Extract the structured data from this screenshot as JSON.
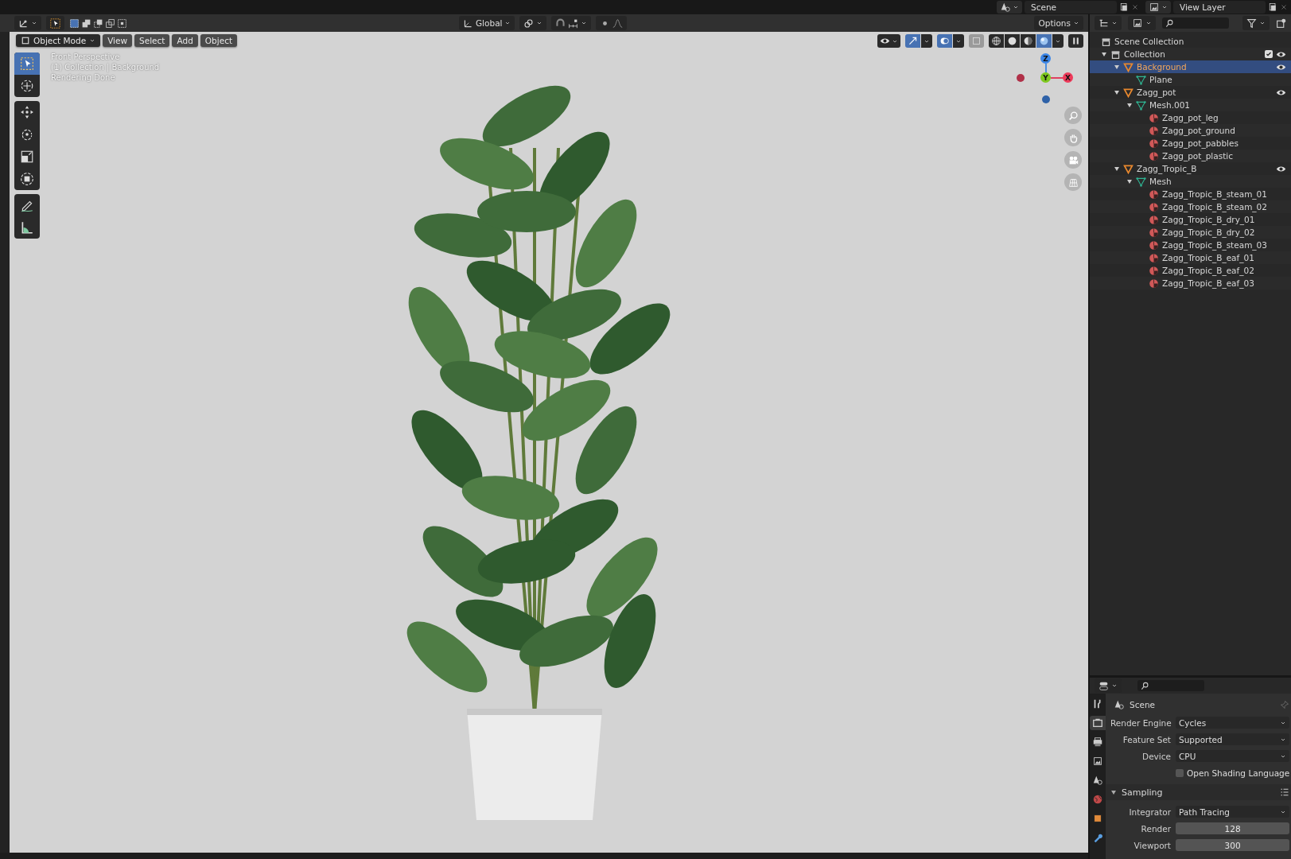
{
  "topbar": {
    "scene": "Scene",
    "view_layer": "View Layer"
  },
  "tool_header": {
    "orientation": "Global",
    "options": "Options"
  },
  "viewport_header": {
    "mode": "Object Mode",
    "menus": [
      "View",
      "Select",
      "Add",
      "Object"
    ]
  },
  "tools": [
    {
      "kind": "select",
      "selected": true
    },
    {
      "kind": "cursor",
      "selected": false
    },
    {
      "kind": "move",
      "selected": false
    },
    {
      "kind": "rotate",
      "selected": false
    },
    {
      "kind": "scale",
      "selected": false
    },
    {
      "kind": "transform",
      "selected": false
    },
    {
      "kind": "annotate",
      "selected": false
    },
    {
      "kind": "measure",
      "selected": false
    }
  ],
  "overlay_text": [
    "Front Perspective",
    "(1) Collection | Background",
    "Rendering Done"
  ],
  "gizmo": {
    "z": "Z",
    "y": "Y",
    "x": "X"
  },
  "shading": [
    {
      "kind": "wireframe",
      "selected": false
    },
    {
      "kind": "solid",
      "selected": false
    },
    {
      "kind": "material",
      "selected": false
    },
    {
      "kind": "rendered",
      "selected": true
    }
  ],
  "outliner": {
    "root": "Scene Collection",
    "tree": [
      {
        "name": "Collection",
        "kind": "collection",
        "expanded": true,
        "checked": true,
        "visible": true,
        "selected": false,
        "children": [
          {
            "name": "Background",
            "kind": "object",
            "expanded": true,
            "visible": true,
            "selected": true,
            "children": [
              {
                "name": "Plane",
                "kind": "mesh",
                "selected": false
              }
            ]
          },
          {
            "name": "Zagg_pot",
            "kind": "object",
            "expanded": true,
            "visible": true,
            "selected": false,
            "children": [
              {
                "name": "Mesh.001",
                "kind": "mesh",
                "expanded": true,
                "selected": false,
                "children": [
                  {
                    "name": "Zagg_pot_leg",
                    "kind": "material",
                    "selected": false
                  },
                  {
                    "name": "Zagg_pot_ground",
                    "kind": "material",
                    "selected": false
                  },
                  {
                    "name": "Zagg_pot_pabbles",
                    "kind": "material",
                    "selected": false
                  },
                  {
                    "name": "Zagg_pot_plastic",
                    "kind": "material",
                    "selected": false
                  }
                ]
              }
            ]
          },
          {
            "name": "Zagg_Tropic_B",
            "kind": "object",
            "expanded": true,
            "visible": true,
            "selected": false,
            "children": [
              {
                "name": "Mesh",
                "kind": "mesh",
                "expanded": true,
                "selected": false,
                "children": [
                  {
                    "name": "Zagg_Tropic_B_steam_01",
                    "kind": "material",
                    "selected": false
                  },
                  {
                    "name": "Zagg_Tropic_B_steam_02",
                    "kind": "material",
                    "selected": false
                  },
                  {
                    "name": "Zagg_Tropic_B_dry_01",
                    "kind": "material",
                    "selected": false
                  },
                  {
                    "name": "Zagg_Tropic_B_dry_02",
                    "kind": "material",
                    "selected": false
                  },
                  {
                    "name": "Zagg_Tropic_B_steam_03",
                    "kind": "material",
                    "selected": false
                  },
                  {
                    "name": "Zagg_Tropic_B_eaf_01",
                    "kind": "material",
                    "selected": false
                  },
                  {
                    "name": "Zagg_Tropic_B_eaf_02",
                    "kind": "material",
                    "selected": false
                  },
                  {
                    "name": "Zagg_Tropic_B_eaf_03",
                    "kind": "material",
                    "selected": false
                  }
                ]
              }
            ]
          }
        ]
      }
    ]
  },
  "properties": {
    "tabs": [
      {
        "kind": "tool",
        "selected": false
      },
      {
        "kind": "render",
        "selected": true
      },
      {
        "kind": "output",
        "selected": false
      },
      {
        "kind": "view_layer",
        "selected": false
      },
      {
        "kind": "scene",
        "selected": false
      },
      {
        "kind": "world",
        "selected": false
      },
      {
        "kind": "object",
        "selected": false
      },
      {
        "kind": "modifier",
        "selected": false
      }
    ],
    "context": "Scene",
    "fields": [
      {
        "kind": "dropdown",
        "label": "Render Engine",
        "value": "Cycles"
      },
      {
        "kind": "dropdown",
        "label": "Feature Set",
        "value": "Supported"
      },
      {
        "kind": "dropdown",
        "label": "Device",
        "value": "CPU"
      },
      {
        "kind": "checkbox",
        "label": "Open Shading Language",
        "checked": false
      }
    ],
    "section": {
      "title": "Sampling",
      "expanded": true
    },
    "section_fields": [
      {
        "kind": "dropdown",
        "label": "Integrator",
        "value": "Path Tracing"
      },
      {
        "kind": "number",
        "label": "Render",
        "value": "128"
      },
      {
        "kind": "number",
        "label": "Viewport",
        "value": "300"
      }
    ]
  }
}
